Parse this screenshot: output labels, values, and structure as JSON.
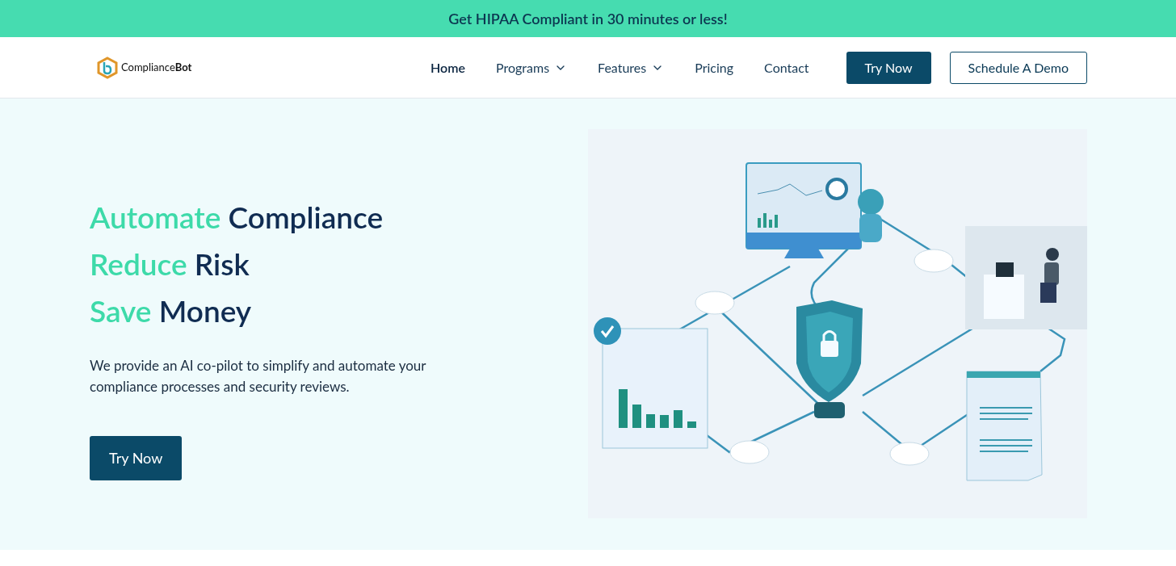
{
  "banner": {
    "text": "Get HIPAA Compliant in 30 minutes or less!"
  },
  "header": {
    "logo": "Compliance**Bot**",
    "nav": [
      {
        "label": "Home",
        "selected": true,
        "dropdown": false
      },
      {
        "label": "Programs",
        "selected": false,
        "dropdown": true
      },
      {
        "label": "Features",
        "selected": false,
        "dropdown": true
      },
      {
        "label": "Pricing",
        "selected": false,
        "dropdown": false
      },
      {
        "label": "Contact",
        "selected": false,
        "dropdown": false
      }
    ],
    "buttons": [
      {
        "label": "Try Now",
        "kind": "primary"
      },
      {
        "label": "Schedule A Demo",
        "kind": "outline"
      }
    ]
  },
  "hero": {
    "headline": [
      {
        "accent": "Automate",
        "rest": "Compliance"
      },
      {
        "accent": "Reduce",
        "rest": "Risk"
      },
      {
        "accent": "Save",
        "rest": "Money"
      }
    ],
    "description": "We provide an AI co-pilot to simplify and automate your compliance processes and security reviews.",
    "button": "Try Now"
  }
}
